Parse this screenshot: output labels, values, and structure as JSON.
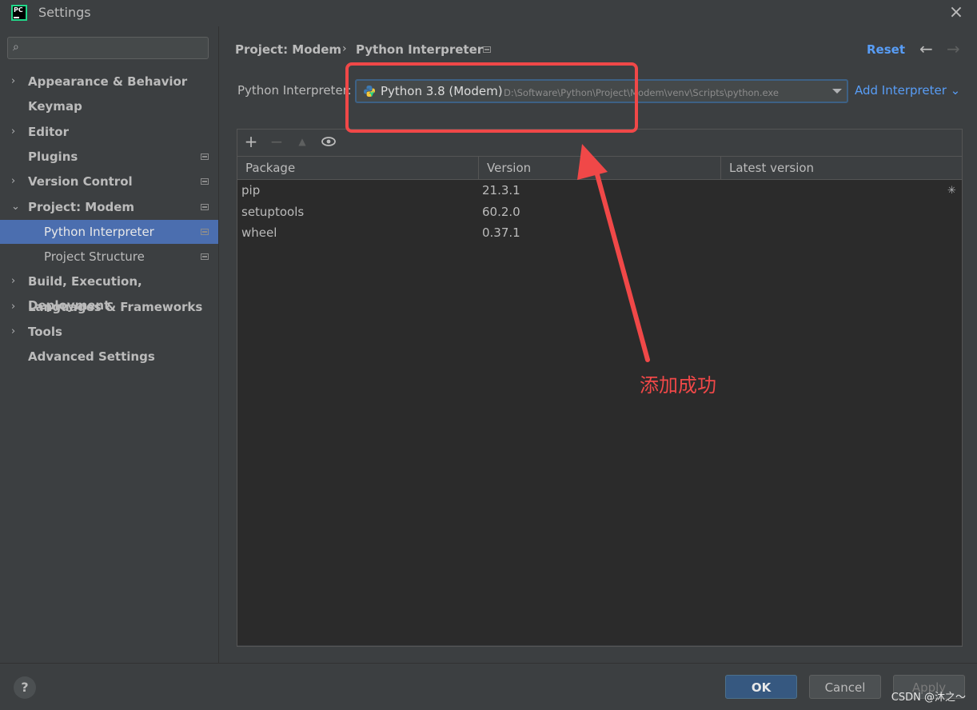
{
  "window": {
    "title": "Settings",
    "logo": "pycharm-logo",
    "logo_text": "PC"
  },
  "search": {
    "placeholder": "",
    "value": ""
  },
  "sidebar": {
    "items": [
      {
        "label": "Appearance & Behavior",
        "arrow": "›",
        "badge": false,
        "selected": false
      },
      {
        "label": "Keymap",
        "arrow": "",
        "badge": false,
        "selected": false
      },
      {
        "label": "Editor",
        "arrow": "›",
        "badge": false,
        "selected": false
      },
      {
        "label": "Plugins",
        "arrow": "",
        "badge": true,
        "selected": false
      },
      {
        "label": "Version Control",
        "arrow": "›",
        "badge": true,
        "selected": false
      },
      {
        "label": "Project: Modem",
        "arrow": "⌄",
        "badge": true,
        "selected": false
      },
      {
        "label": "Python Interpreter",
        "arrow": "",
        "badge": true,
        "selected": true,
        "child": true
      },
      {
        "label": "Project Structure",
        "arrow": "",
        "badge": true,
        "selected": false,
        "child": true
      },
      {
        "label": "Build, Execution, Deployment",
        "arrow": "›",
        "badge": false,
        "selected": false
      },
      {
        "label": "Languages & Frameworks",
        "arrow": "›",
        "badge": false,
        "selected": false
      },
      {
        "label": "Tools",
        "arrow": "›",
        "badge": false,
        "selected": false
      },
      {
        "label": "Advanced Settings",
        "arrow": "",
        "badge": false,
        "selected": false
      }
    ]
  },
  "breadcrumb": {
    "parent": "Project: Modem",
    "separator": "›",
    "current": "Python Interpreter"
  },
  "header": {
    "reset_label": "Reset",
    "back_icon": "←",
    "forward_icon": "→"
  },
  "interpreter": {
    "label": "Python Interpreter:",
    "name": "Python 3.8 (Modem)",
    "path": "D:\\Software\\Python\\Project\\Modem\\venv\\Scripts\\python.exe",
    "add_label": "Add Interpreter ⌄"
  },
  "toolbar": {
    "add": "+",
    "remove": "−",
    "up": "▲",
    "show": "👁"
  },
  "packages": {
    "columns": [
      "Package",
      "Version",
      "Latest version"
    ],
    "rows": [
      {
        "name": "pip",
        "version": "21.3.1",
        "latest": ""
      },
      {
        "name": "setuptools",
        "version": "60.2.0",
        "latest": ""
      },
      {
        "name": "wheel",
        "version": "0.37.1",
        "latest": ""
      }
    ]
  },
  "footer": {
    "help": "?",
    "ok": "OK",
    "cancel": "Cancel",
    "apply": "Apply"
  },
  "annotation": {
    "text": "添加成功",
    "color": "#f04848"
  },
  "watermark": "CSDN @沐之～",
  "colors": {
    "accent": "#589df6",
    "selection": "#4b6eaf",
    "annotation": "#f04848"
  }
}
